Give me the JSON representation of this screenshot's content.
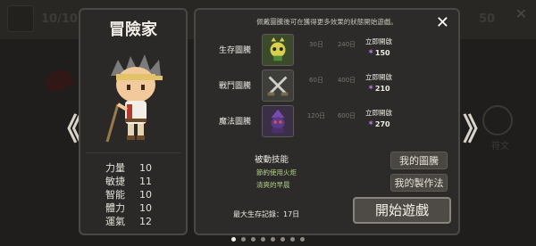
{
  "background": {
    "top_left_count": "10/10",
    "top_right_value": "50",
    "rune_label": "符文",
    "close_icon": "close-icon"
  },
  "nav": {
    "prev_label": "《",
    "next_label": "》"
  },
  "character": {
    "name": "冒險家",
    "stats": [
      {
        "name": "力量",
        "value": "10"
      },
      {
        "name": "敏捷",
        "value": "11"
      },
      {
        "name": "智能",
        "value": "10"
      },
      {
        "name": "體力",
        "value": "10"
      },
      {
        "name": "運氣",
        "value": "12"
      }
    ]
  },
  "dialog": {
    "hint": "佩戴圖騰後可在獲得更多效果的狀態開始遊戲。",
    "close_label": "✕",
    "totems": [
      {
        "label": "生存圖騰",
        "icon": "skull-totem-icon",
        "c1_top": "30日",
        "c1_bottom": "",
        "c2_top": "240日",
        "c2_bottom": "",
        "unlock_label": "立即開啟",
        "price": "150",
        "color": "#3a4a2a"
      },
      {
        "label": "戰鬥圖騰",
        "icon": "swords-totem-icon",
        "c1_top": "60日",
        "c1_bottom": "",
        "c2_top": "400日",
        "c2_bottom": "",
        "unlock_label": "立即開啟",
        "price": "210",
        "color": "#3e3f3a"
      },
      {
        "label": "魔法圖騰",
        "icon": "mage-totem-icon",
        "c1_top": "120日",
        "c1_bottom": "",
        "c2_top": "600日",
        "c2_bottom": "",
        "unlock_label": "立即開啟",
        "price": "270",
        "color": "#3a2f45"
      }
    ],
    "passive_title": "被動技能",
    "passives": [
      "節約使用火炬",
      "清爽的早晨"
    ],
    "my_totems_label": "我的圖騰",
    "my_crafting_label": "我的製作法",
    "record_label": "最大生存記錄：17日",
    "start_label": "開始遊戲",
    "currency_icon": "star-gem-icon"
  },
  "pagination": {
    "count": 8,
    "active": 0
  }
}
